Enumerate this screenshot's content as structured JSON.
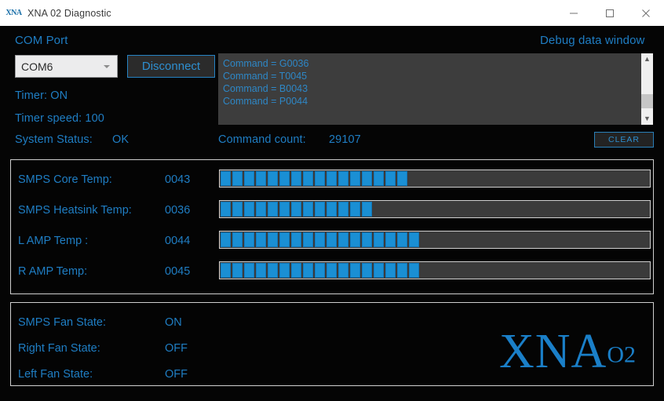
{
  "window": {
    "title": "XNA 02 Diagnostic",
    "icon": "xna-app-icon",
    "minimize": "minimize-icon",
    "maximize": "maximize-icon",
    "close": "close-icon"
  },
  "com": {
    "heading": "COM Port",
    "selected_port": "COM6",
    "options": [
      "COM6"
    ],
    "disconnect_label": "Disconnect",
    "timer_label": "Timer: ON",
    "timer_speed_label": "Timer speed: 100",
    "system_status_label": "System Status:",
    "system_status_value": "OK"
  },
  "debug": {
    "heading": "Debug data window",
    "lines": [
      "Command = G0036",
      "Command = T0045",
      "Command = B0043",
      "Command = P0044"
    ],
    "command_count_label": "Command count:",
    "command_count_value": "29107",
    "clear_label": "CLEAR",
    "scroll_up_icon": "chevron-up-icon",
    "scroll_down_icon": "chevron-down-icon"
  },
  "temperatures": [
    {
      "name": "SMPS Core Temp:",
      "value": "0043",
      "segments": 16
    },
    {
      "name": "SMPS Heatsink Temp:",
      "value": "0036",
      "segments": 13
    },
    {
      "name": "L AMP Temp :",
      "value": "0044",
      "segments": 17
    },
    {
      "name": "R AMP Temp:",
      "value": "0045",
      "segments": 17
    }
  ],
  "fans": [
    {
      "name": "SMPS Fan State:",
      "value": "ON"
    },
    {
      "name": "Right Fan State:",
      "value": "OFF"
    },
    {
      "name": "Left Fan State:",
      "value": "OFF"
    }
  ],
  "logo": {
    "main": "XNA",
    "superscript": "O2"
  },
  "colors": {
    "accent_blue": "#1f7ec4",
    "bar_fill": "#1a8fd4",
    "bar_track": "#3b3b3b",
    "background": "#050505",
    "titlebar": "#ffffff"
  }
}
